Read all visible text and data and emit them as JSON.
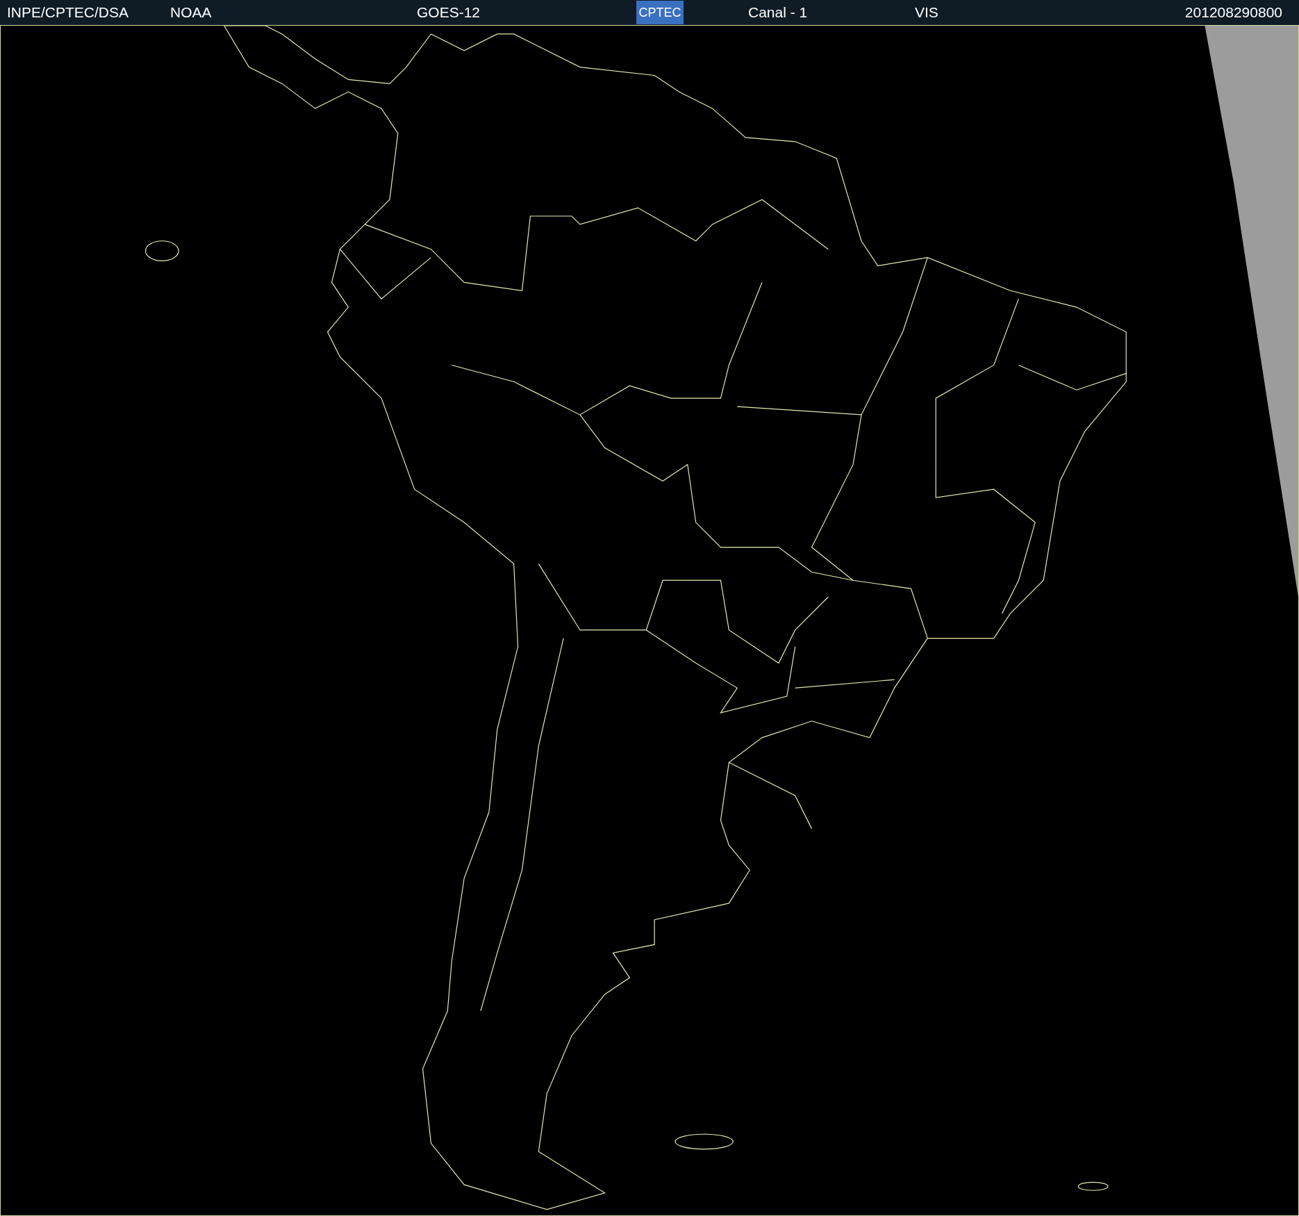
{
  "header": {
    "source": "INPE/CPTEC/DSA",
    "agency": "NOAA",
    "satellite": "GOES-12",
    "logo": "CPTEC",
    "channel": "Canal - 1",
    "band": "VIS",
    "timestamp": "201208290800"
  }
}
